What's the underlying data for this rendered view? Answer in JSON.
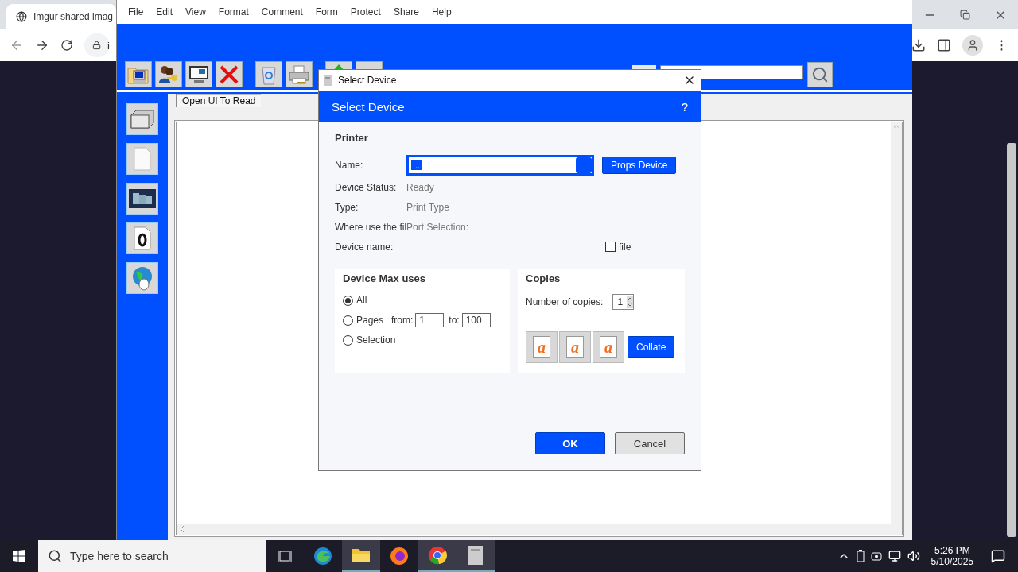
{
  "browser": {
    "tab_title": "Imgur shared imag",
    "address": "i"
  },
  "app": {
    "menu": [
      "File",
      "Edit",
      "View",
      "Format",
      "Comment",
      "Form",
      "Protect",
      "Share",
      "Help"
    ],
    "doc_tab": {
      "label": "Open UI To Read"
    }
  },
  "dialog": {
    "window_title": "Select Device",
    "header": "Select Device",
    "help": "?",
    "section": "Printer",
    "name_label": "Name:",
    "name_value": "...",
    "props_button": "Props Device",
    "fields": [
      {
        "label": "Device Status:",
        "value": "Ready"
      },
      {
        "label": "Type:",
        "value": "Print Type"
      },
      {
        "label": "Where use the fil",
        "value": "Port Selection:"
      }
    ],
    "device_name_label": "Device name:",
    "file_checkbox": {
      "label": "file",
      "checked": false
    },
    "range": {
      "title": "Device Max uses",
      "options": [
        {
          "label": "All",
          "selected": true
        },
        {
          "label": "Pages",
          "selected": false
        },
        {
          "label": "Selection",
          "selected": false
        }
      ],
      "from_label": "from:",
      "from": "1",
      "to_label": "to:",
      "to": "100"
    },
    "copies": {
      "title": "Copies",
      "label": "Number of copies:",
      "value": "1",
      "pages": [
        "a",
        "a",
        "a"
      ],
      "collate": "Collate"
    },
    "buttons": [
      {
        "label": "OK",
        "kind": "primary"
      },
      {
        "label": "Cancel",
        "kind": "secondary"
      }
    ]
  },
  "taskbar": {
    "search_placeholder": "Type here to search",
    "time": "5:26 PM",
    "date": "5/10/2025"
  }
}
